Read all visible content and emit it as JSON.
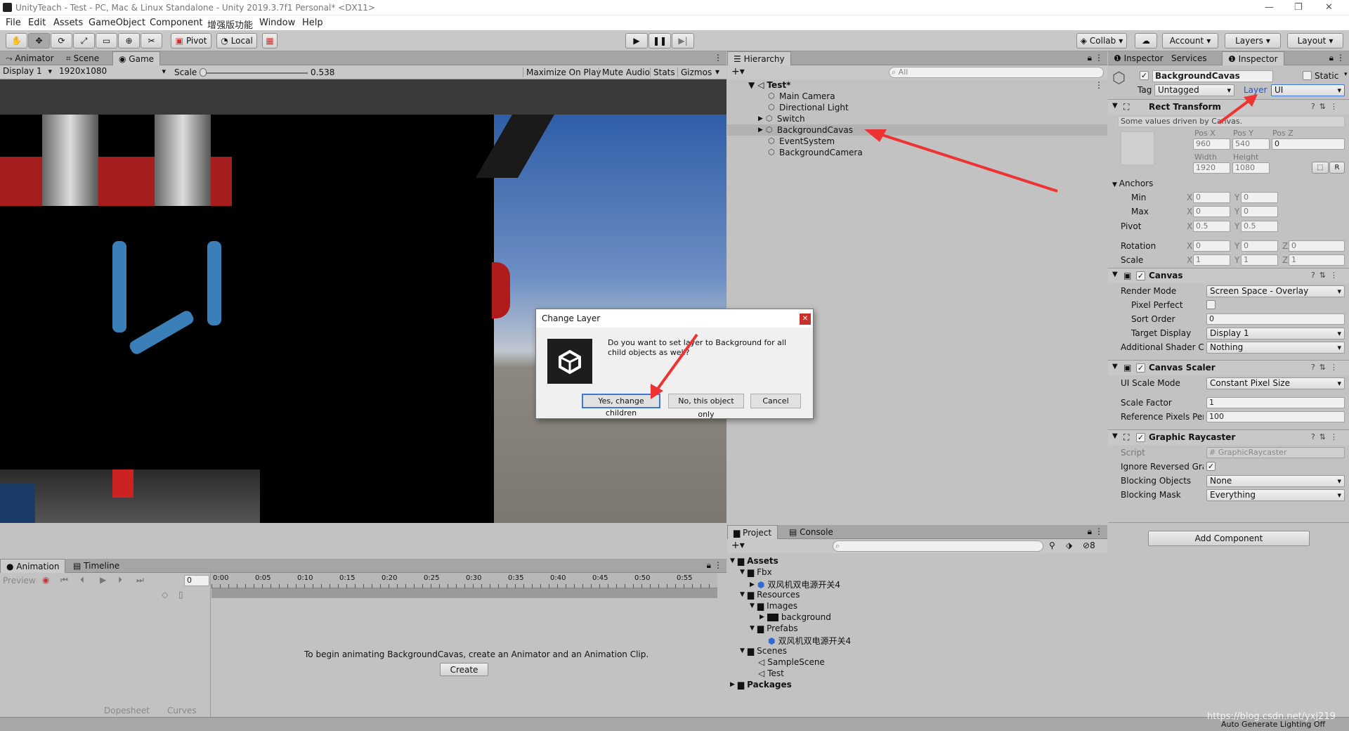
{
  "window": {
    "title": "UnityTeach - Test - PC, Mac & Linux Standalone - Unity 2019.3.7f1 Personal* <DX11>",
    "controls": [
      "—",
      "❐",
      "✕"
    ]
  },
  "menu": [
    "File",
    "Edit",
    "Assets",
    "GameObject",
    "Component",
    "增强版功能",
    "Window",
    "Help"
  ],
  "toolbar": {
    "pivot": "Pivot",
    "local": "Local",
    "collab": "Collab",
    "account": "Account",
    "layers": "Layers",
    "layout": "Layout"
  },
  "game_view": {
    "tabs": [
      "Animator",
      "Scene",
      "Game"
    ],
    "display": "Display 1",
    "resolution": "1920x1080",
    "scale_label": "Scale",
    "scale_value": "0.538",
    "options": [
      "Maximize On Play",
      "Mute Audio",
      "Stats",
      "Gizmos"
    ]
  },
  "hierarchy": {
    "tab": "Hierarchy",
    "search_placeholder": "All",
    "scene": "Test*",
    "items": [
      "Main Camera",
      "Directional Light",
      "Switch",
      "BackgroundCavas",
      "EventSystem",
      "BackgroundCamera"
    ]
  },
  "inspector": {
    "tabs": [
      "Inspector",
      "Services",
      "Inspector"
    ],
    "object_name": "BackgroundCavas",
    "static_label": "Static",
    "tag_label": "Tag",
    "tag_value": "Untagged",
    "layer_label": "Layer",
    "layer_value": "UI",
    "rect_transform": {
      "title": "Rect Transform",
      "note": "Some values driven by Canvas.",
      "pos_x_label": "Pos X",
      "pos_y_label": "Pos Y",
      "pos_z_label": "Pos Z",
      "pos_x": "960",
      "pos_y": "540",
      "pos_z": "0",
      "width_label": "Width",
      "height_label": "Height",
      "width": "1920",
      "height": "1080",
      "r_button": "R",
      "anchors_label": "Anchors",
      "min_label": "Min",
      "max_label": "Max",
      "min_x": "0",
      "min_y": "0",
      "max_x": "0",
      "max_y": "0",
      "pivot_label": "Pivot",
      "pivot_x": "0.5",
      "pivot_y": "0.5",
      "rotation_label": "Rotation",
      "rot_x": "0",
      "rot_y": "0",
      "rot_z": "0",
      "scale_label": "Scale",
      "scale_x": "1",
      "scale_y": "1",
      "scale_z": "1",
      "x": "X",
      "y": "Y",
      "z": "Z"
    },
    "canvas": {
      "title": "Canvas",
      "render_mode_label": "Render Mode",
      "render_mode": "Screen Space - Overlay",
      "pixel_perfect_label": "Pixel Perfect",
      "sort_order_label": "Sort Order",
      "sort_order": "0",
      "target_display_label": "Target Display",
      "target_display": "Display 1",
      "shader_label": "Additional Shader Ch",
      "shader_value": "Nothing"
    },
    "canvas_scaler": {
      "title": "Canvas Scaler",
      "ui_scale_mode_label": "UI Scale Mode",
      "ui_scale_mode": "Constant Pixel Size",
      "scale_factor_label": "Scale Factor",
      "scale_factor": "1",
      "ref_pixels_label": "Reference Pixels Per",
      "ref_pixels": "100"
    },
    "graphic_raycaster": {
      "title": "Graphic Raycaster",
      "script_label": "Script",
      "script_value": "GraphicRaycaster",
      "ignore_label": "Ignore Reversed Grap",
      "blocking_objects_label": "Blocking Objects",
      "blocking_objects": "None",
      "blocking_mask_label": "Blocking Mask",
      "blocking_mask": "Everything"
    },
    "add_component": "Add Component"
  },
  "project": {
    "tabs": [
      "Project",
      "Console"
    ],
    "hidden_count": "8",
    "tree": [
      {
        "label": "Assets",
        "bold": true
      },
      {
        "label": "Fbx"
      },
      {
        "label": "双风机双电源开关4"
      },
      {
        "label": "Resources"
      },
      {
        "label": "Images"
      },
      {
        "label": "background"
      },
      {
        "label": "Prefabs"
      },
      {
        "label": "双风机双电源开关4"
      },
      {
        "label": "Scenes"
      },
      {
        "label": "SampleScene"
      },
      {
        "label": "Test"
      },
      {
        "label": "Packages",
        "bold": true
      }
    ]
  },
  "animation": {
    "tabs": [
      "Animation",
      "Timeline"
    ],
    "preview": "Preview",
    "frame": "0",
    "ticks": [
      "0:00",
      "0:05",
      "0:10",
      "0:15",
      "0:20",
      "0:25",
      "0:30",
      "0:35",
      "0:40",
      "0:45",
      "0:50",
      "0:55"
    ],
    "message": "To begin animating BackgroundCavas, create an Animator and an Animation Clip.",
    "create_button": "Create",
    "bottom_tabs": [
      "Dopesheet",
      "Curves"
    ]
  },
  "dialog": {
    "title": "Change Layer",
    "message": "Do you want to set layer to Background for all child objects as well?",
    "yes": "Yes, change children",
    "no": "No, this object only",
    "cancel": "Cancel"
  },
  "status": {
    "right": "Auto Generate Lighting Off",
    "watermark": "https://blog.csdn.net/yxj219"
  },
  "colors": {
    "annotation_arrow": "#ee3333",
    "selected_tab": "#cbcbcb",
    "sky_top": "#3f6fb7",
    "dialog_primary_border": "#3b78d8"
  }
}
